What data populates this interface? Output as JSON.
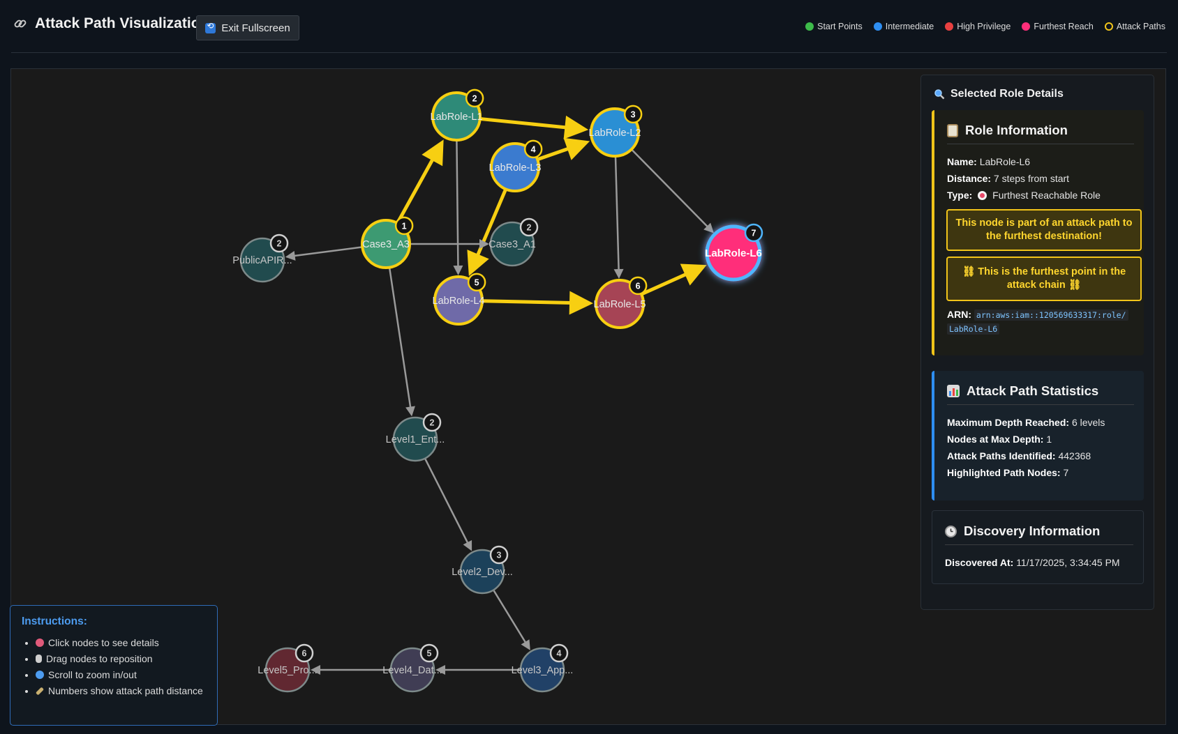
{
  "header": {
    "title": "Attack Path Visualization",
    "exit_button": "Exit Fullscreen",
    "legend": [
      {
        "label": "Start Points",
        "color": "#3dbb4a",
        "style": "fill"
      },
      {
        "label": "Intermediate",
        "color": "#2e8ef2",
        "style": "fill"
      },
      {
        "label": "High Privilege",
        "color": "#e84040",
        "style": "fill"
      },
      {
        "label": "Furthest Reach",
        "color": "#ff2e7a",
        "style": "fill"
      },
      {
        "label": "Attack Paths",
        "color": "#f2c51a",
        "style": "ring"
      }
    ]
  },
  "graph": {
    "nodes": [
      {
        "id": "l1",
        "label": "LabRole-L1",
        "badge": "2",
        "highlight": true
      },
      {
        "id": "l2",
        "label": "LabRole-L2",
        "badge": "3",
        "highlight": true
      },
      {
        "id": "l3",
        "label": "LabRole-L3",
        "badge": "4",
        "highlight": true
      },
      {
        "id": "a3",
        "label": "Case3_A3",
        "badge": "1",
        "highlight": true
      },
      {
        "id": "a1",
        "label": "Case3_A1",
        "badge": "2",
        "highlight": false
      },
      {
        "id": "pub",
        "label": "PublicAPIR...",
        "badge": "2",
        "highlight": false
      },
      {
        "id": "l4",
        "label": "LabRole-L4",
        "badge": "5",
        "highlight": true
      },
      {
        "id": "l5",
        "label": "LabRole-L5",
        "badge": "6",
        "highlight": true
      },
      {
        "id": "l6",
        "label": "LabRole-L6",
        "badge": "7",
        "highlight": true,
        "selected": true
      },
      {
        "id": "lv1",
        "label": "Level1_Ent...",
        "badge": "2",
        "highlight": false
      },
      {
        "id": "lv2",
        "label": "Level2_Dev...",
        "badge": "3",
        "highlight": false
      },
      {
        "id": "lv3",
        "label": "Level3_App...",
        "badge": "4",
        "highlight": false
      },
      {
        "id": "lv4",
        "label": "Level4_Dat...",
        "badge": "5",
        "highlight": false
      },
      {
        "id": "lv5",
        "label": "Level5_Pro...",
        "badge": "6",
        "highlight": false
      }
    ],
    "edges": [
      {
        "from": "a3",
        "to": "l1",
        "attack": true
      },
      {
        "from": "l1",
        "to": "l2",
        "attack": true
      },
      {
        "from": "l3",
        "to": "l2",
        "attack": true
      },
      {
        "from": "l3",
        "to": "l4",
        "attack": true
      },
      {
        "from": "l4",
        "to": "l5",
        "attack": true
      },
      {
        "from": "l5",
        "to": "l6",
        "attack": true
      },
      {
        "from": "l1",
        "to": "l4",
        "attack": false
      },
      {
        "from": "l2",
        "to": "l5",
        "attack": false
      },
      {
        "from": "l2",
        "to": "l6",
        "attack": false
      },
      {
        "from": "a3",
        "to": "pub",
        "attack": false
      },
      {
        "from": "a3",
        "to": "a1",
        "attack": false
      },
      {
        "from": "a3",
        "to": "lv1",
        "attack": false
      },
      {
        "from": "lv1",
        "to": "lv2",
        "attack": false
      },
      {
        "from": "lv2",
        "to": "lv3",
        "attack": false
      },
      {
        "from": "lv3",
        "to": "lv4",
        "attack": false
      },
      {
        "from": "lv4",
        "to": "lv5",
        "attack": false
      }
    ]
  },
  "details": {
    "heading": "Selected Role Details",
    "role_info": {
      "title": "Role Information",
      "name_label": "Name:",
      "name": "LabRole-L6",
      "distance_label": "Distance:",
      "distance": "7 steps from start",
      "type_label": "Type:",
      "type": "Furthest Reachable Role",
      "warning_path": "This node is part of an attack path to the furthest destination!",
      "warning_furthest": "⛓ This is the furthest point in the attack chain ⛓",
      "arn_label": "ARN:",
      "arn_line1": "arn:aws:iam::120569633317:role/",
      "arn_line2": "LabRole-L6"
    },
    "stats": {
      "title": "Attack Path Statistics",
      "max_depth_label": "Maximum Depth Reached:",
      "max_depth": "6 levels",
      "nodes_max_label": "Nodes at Max Depth:",
      "nodes_max": "1",
      "paths_label": "Attack Paths Identified:",
      "paths": "442368",
      "highlighted_label": "Highlighted Path Nodes:",
      "highlighted": "7"
    },
    "discovery": {
      "title": "Discovery Information",
      "discovered_label": "Discovered At:",
      "discovered": "11/17/2025, 3:34:45 PM"
    }
  },
  "instructions": {
    "title": "Instructions:",
    "items": [
      "Click nodes to see details",
      "Drag nodes to reposition",
      "Scroll to zoom in/out",
      "Numbers show attack path distance"
    ]
  },
  "colors": {
    "attack": "#f7cf12",
    "edge": "#9a9a9a",
    "selected_ring": "#4fb6ff",
    "furthest": "#ff2e7a"
  }
}
